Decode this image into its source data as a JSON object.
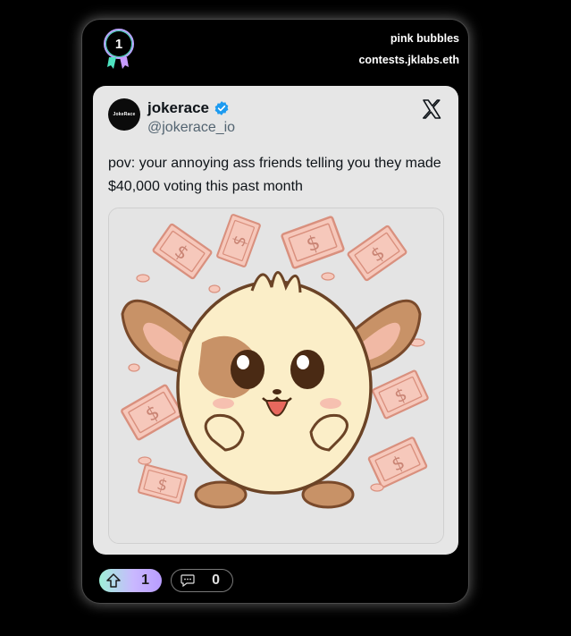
{
  "submission": {
    "rank": "1",
    "title": "pink bubbles",
    "contest_domain": "contests.jklabs.eth"
  },
  "tweet": {
    "avatar_text": "JokeRace",
    "author_name": "jokerace",
    "author_handle": "@jokerace_io",
    "text": "pov: your annoying ass friends telling you they made $40,000 voting this past month",
    "verified": true
  },
  "actions": {
    "votes": "1",
    "comments": "0"
  },
  "colors": {
    "card_bg": "#000000",
    "tweet_bg": "#e6e6e6",
    "verified_blue": "#1d9bf0",
    "vote_gradient_start": "#9ff0d8",
    "vote_gradient_end": "#b89cff"
  },
  "icons": [
    "rank-medal-icon",
    "verified-badge-icon",
    "x-logo-icon",
    "upvote-arrow-icon",
    "comment-icon"
  ]
}
